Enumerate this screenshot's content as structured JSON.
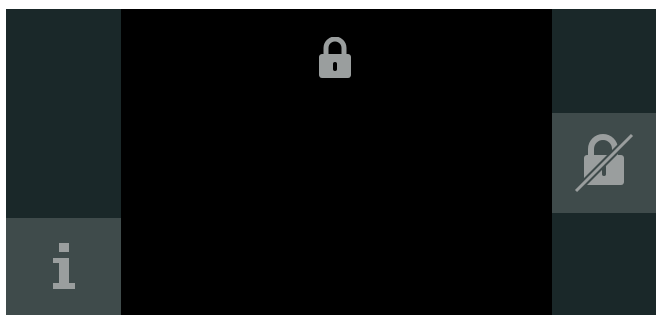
{
  "screen": {
    "status_icon": "lock-icon",
    "state": "locked"
  },
  "left_panel": {
    "info_button": {
      "icon": "info-icon"
    }
  },
  "right_panel": {
    "unlock_button": {
      "icon": "lock-disabled-icon"
    }
  },
  "colors": {
    "background": "#000000",
    "panel": "#1a2829",
    "button": "#3f4b4b",
    "icon": "#9a9e9e"
  }
}
